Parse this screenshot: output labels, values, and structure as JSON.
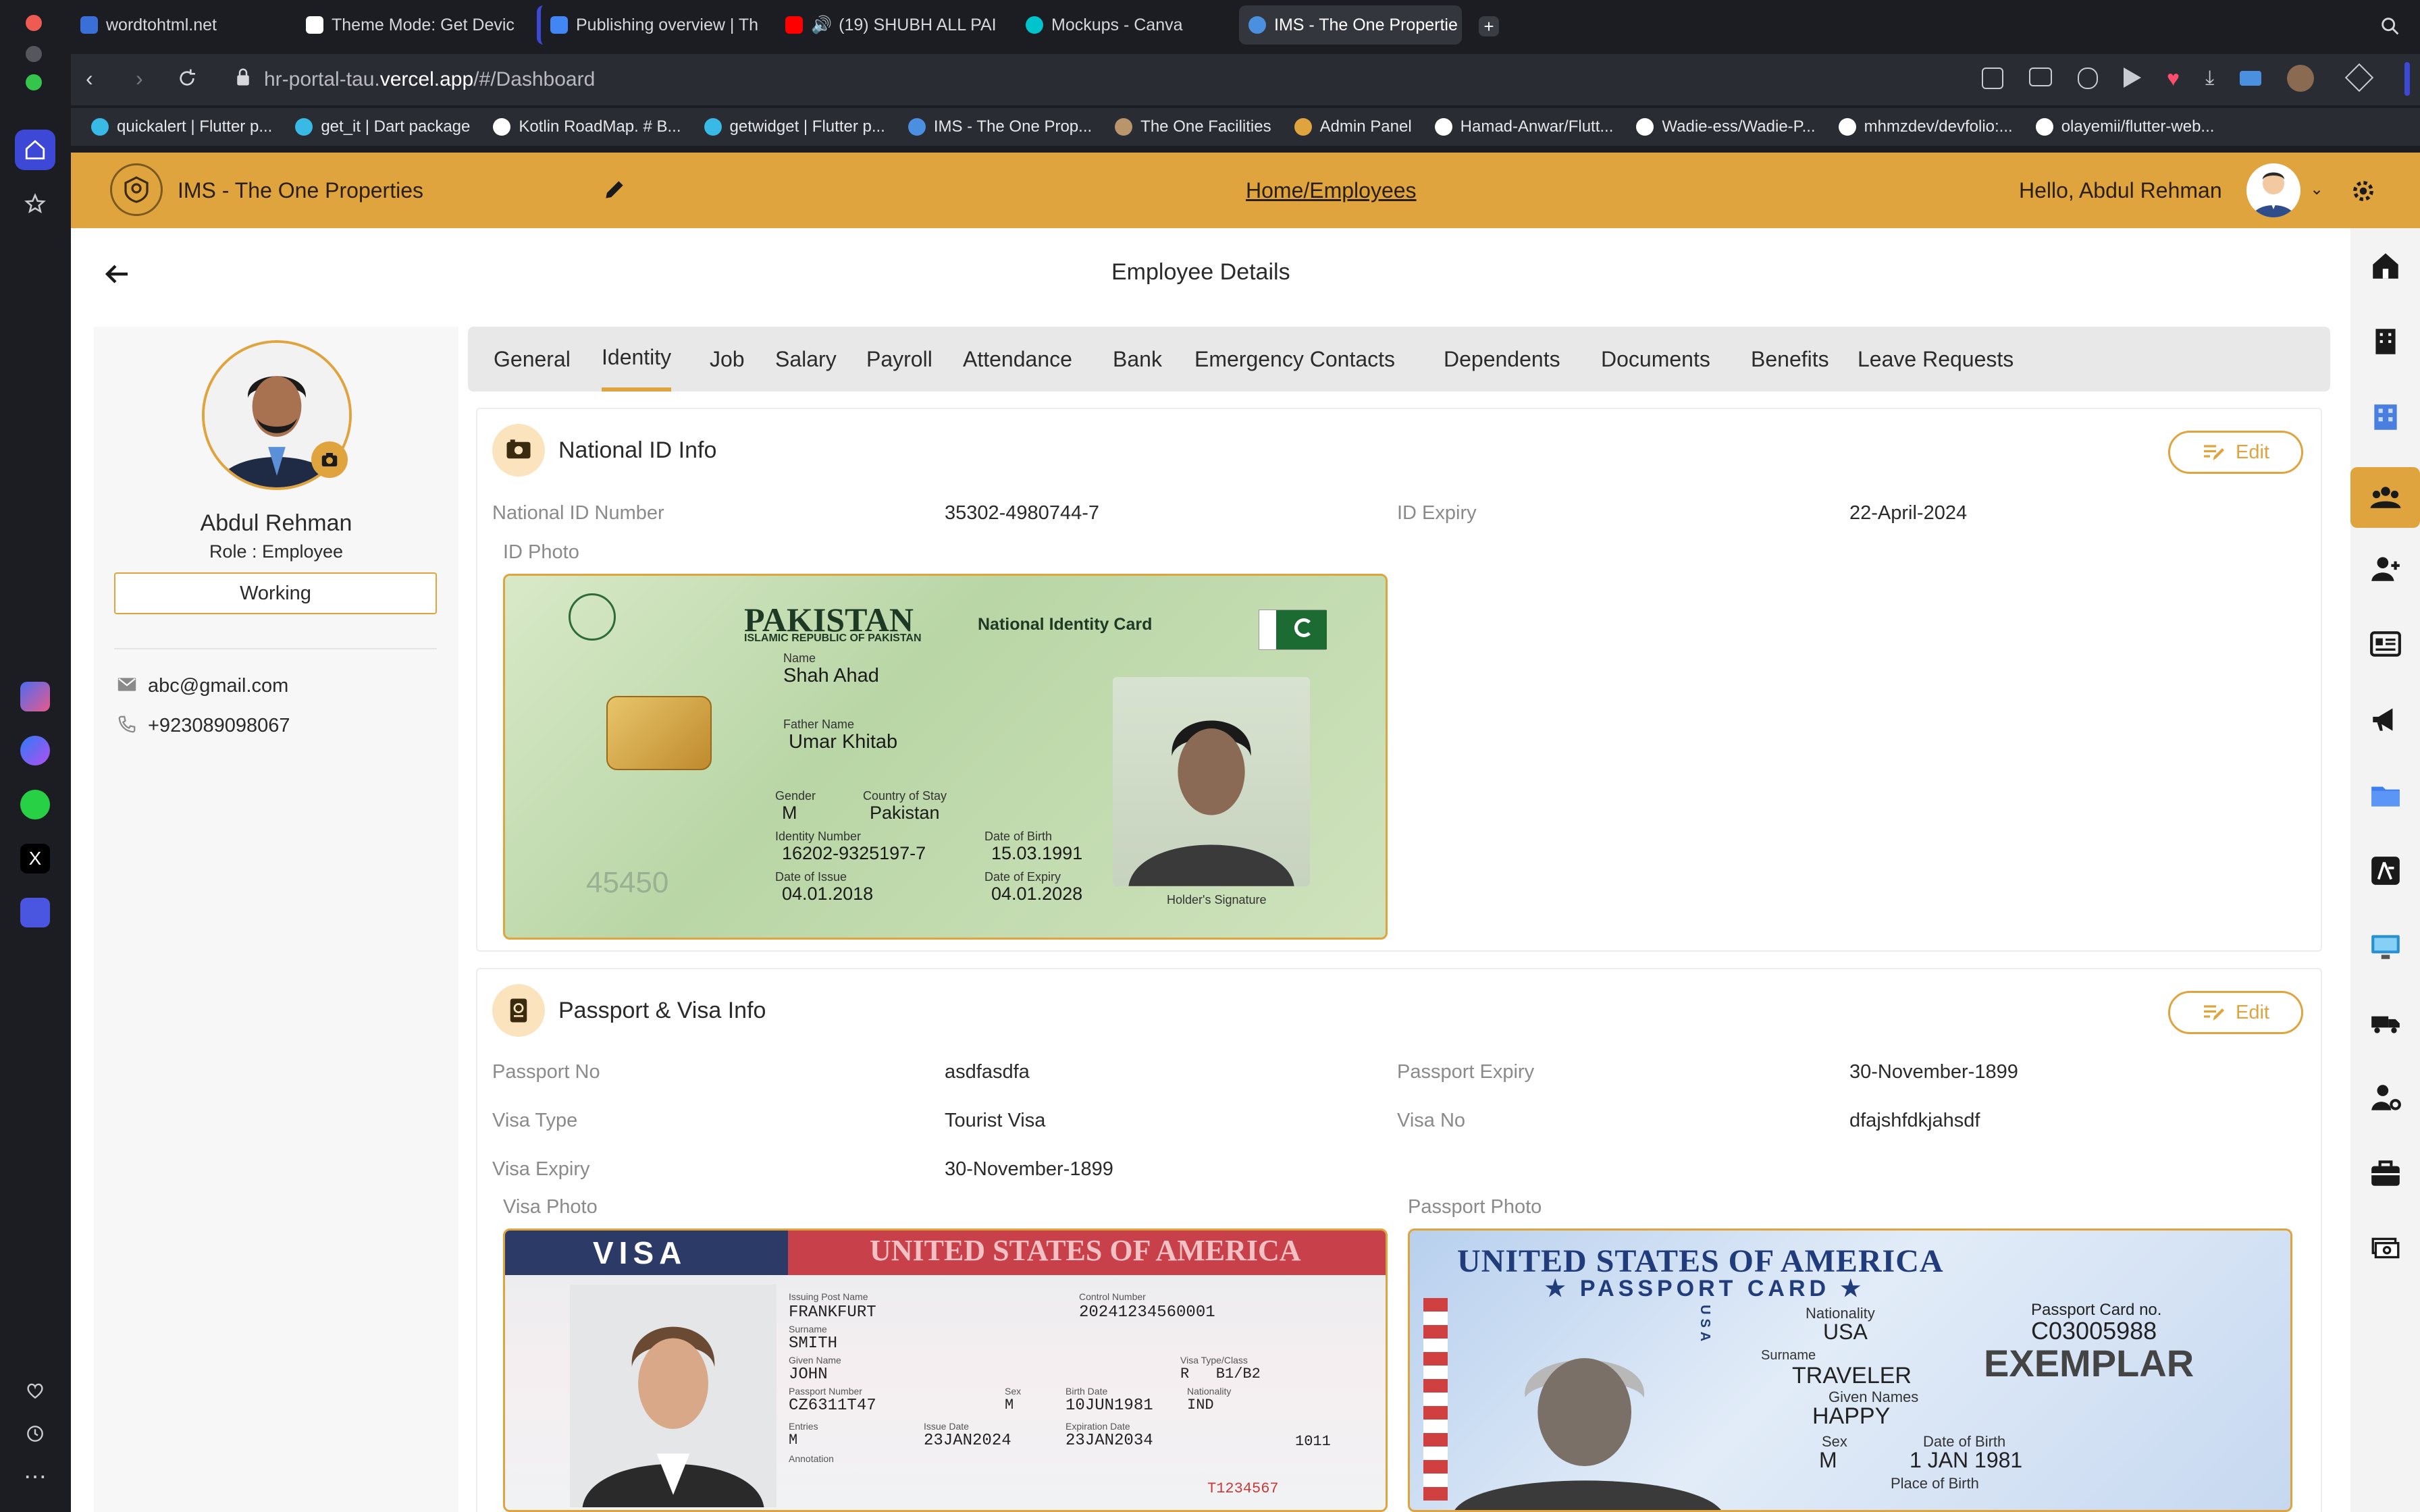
{
  "browser": {
    "tabs": [
      {
        "title": "wordtohtml.net",
        "favicon": "wordtohtml-icon",
        "color": "#3a6fd8"
      },
      {
        "title": "Theme Mode: Get Devic",
        "favicon": "chatgpt-icon",
        "color": "#ffffff"
      },
      {
        "title": "Publishing overview | Th",
        "favicon": "play-console-icon",
        "color": "#4285f4"
      },
      {
        "title": "(19) SHUBH ALL PAI",
        "favicon": "youtube-icon",
        "color": "#ff0000"
      },
      {
        "title": "Mockups - Canva",
        "favicon": "canva-icon",
        "color": "#00c4cc"
      },
      {
        "title": "IMS - The One Propertie",
        "favicon": "app-icon",
        "color": "#4a8fe0"
      }
    ],
    "url_prefix": "hr-portal-tau.",
    "url_domain": "vercel.app",
    "url_path": "/#/Dashboard",
    "bookmarks": [
      {
        "label": "quickalert | Flutter p...",
        "color": "#38b9e6"
      },
      {
        "label": "get_it | Dart package",
        "color": "#38b9e6"
      },
      {
        "label": "Kotlin RoadMap. # B...",
        "color": "#ffffff"
      },
      {
        "label": "getwidget | Flutter p...",
        "color": "#38b9e6"
      },
      {
        "label": "IMS - The One Prop...",
        "color": "#4a8fe0"
      },
      {
        "label": "The One Facilities",
        "color": "#b8956a"
      },
      {
        "label": "Admin Panel",
        "color": "#e0a43f"
      },
      {
        "label": "Hamad-Anwar/Flutt...",
        "color": "#ffffff"
      },
      {
        "label": "Wadie-ess/Wadie-P...",
        "color": "#ffffff"
      },
      {
        "label": "mhmzdev/devfolio:...",
        "color": "#ffffff"
      },
      {
        "label": "olayemii/flutter-web...",
        "color": "#ffffff"
      }
    ]
  },
  "header": {
    "app_title": "IMS - The One Properties",
    "breadcrumb": "Home/Employees",
    "greeting": "Hello, Abdul Rehman"
  },
  "page": {
    "title": "Employee Details"
  },
  "profile": {
    "name": "Abdul Rehman",
    "role": "Role : Employee",
    "status": "Working",
    "email": "abc@gmail.com",
    "phone": "+923089098067"
  },
  "tabs": [
    "General",
    "Identity",
    "Job",
    "Salary",
    "Payroll",
    "Attendance",
    "Bank",
    "Emergency Contacts",
    "Dependents",
    "Documents",
    "Benefits",
    "Leave Requests"
  ],
  "active_tab": "Identity",
  "national_id": {
    "section_title": "National ID Info",
    "edit_label": "Edit",
    "id_number_label": "National ID Number",
    "id_number_value": "35302-4980744-7",
    "expiry_label": "ID Expiry",
    "expiry_value": "22-April-2024",
    "photo_label": "ID Photo",
    "card": {
      "country": "PAKISTAN",
      "republic": "ISLAMIC REPUBLIC OF PAKISTAN",
      "card_title": "National Identity Card",
      "name_label": "Name",
      "name": "Shah Ahad",
      "father_label": "Father Name",
      "father": "Umar Khitab",
      "gender_label": "Gender",
      "gender": "M",
      "country_stay_label": "Country of Stay",
      "country_stay": "Pakistan",
      "id_label": "Identity Number",
      "id_number": "16202-9325197-7",
      "dob_label": "Date of Birth",
      "dob": "15.03.1991",
      "issue_label": "Date of Issue",
      "issue": "04.01.2018",
      "expiry_label": "Date of Expiry",
      "expiry": "04.01.2028",
      "signature_label": "Holder's Signature",
      "serial": "45450"
    }
  },
  "passport": {
    "section_title": "Passport & Visa Info",
    "edit_label": "Edit",
    "passport_no_label": "Passport No",
    "passport_no_value": "asdfasdfa",
    "passport_expiry_label": "Passport Expiry",
    "passport_expiry_value": "30-November-1899",
    "visa_type_label": "Visa Type",
    "visa_type_value": "Tourist Visa",
    "visa_no_label": "Visa No",
    "visa_no_value": "dfajshfdkjahsdf",
    "visa_expiry_label": "Visa Expiry",
    "visa_expiry_value": "30-November-1899",
    "visa_photo_label": "Visa Photo",
    "passport_photo_label": "Passport Photo",
    "visa_card": {
      "title": "VISA",
      "banner": "UNITED STATES OF AMERICA",
      "post_label": "Issuing Post Name",
      "post": "FRANKFURT",
      "control_label": "Control Number",
      "control": "20241234560001",
      "surname_label": "Surname",
      "surname": "SMITH",
      "given_label": "Given Name",
      "given": "JOHN",
      "type_label": "Visa Type/Class",
      "type": "R   B1/B2",
      "ppn_label": "Passport Number",
      "ppn": "CZ6311T47",
      "sex_label": "Sex",
      "sex": "M",
      "birth_label": "Birth Date",
      "birth": "10JUN1981",
      "nat_label": "Nationality",
      "nat": "IND",
      "entries_label": "Entries",
      "entries": "M",
      "issue_label": "Issue Date",
      "issue": "23JAN2024",
      "exp_label": "Expiration Date",
      "exp": "23JAN2034",
      "annotation_label": "Annotation",
      "num": "1011",
      "red": "T1234567"
    },
    "passport_card": {
      "title": "UNITED STATES OF AMERICA",
      "subtitle": "★ PASSPORT CARD ★",
      "usa_vertical": "USA",
      "nationality_label": "Nationality",
      "nationality": "USA",
      "card_no_label": "Passport Card no.",
      "card_no": "C03005988",
      "surname_label": "Surname",
      "surname": "TRAVELER",
      "exemplar": "EXEMPLAR",
      "given_label": "Given Names",
      "given": "HAPPY",
      "sex_label": "Sex",
      "sex": "M",
      "dob_label": "Date of Birth",
      "dob": "1 JAN 1981",
      "pob_label": "Place of Birth"
    }
  },
  "colors": {
    "accent": "#e0a43f",
    "accent_light": "#fbe3bd",
    "browser_bg": "#1c1d22"
  }
}
